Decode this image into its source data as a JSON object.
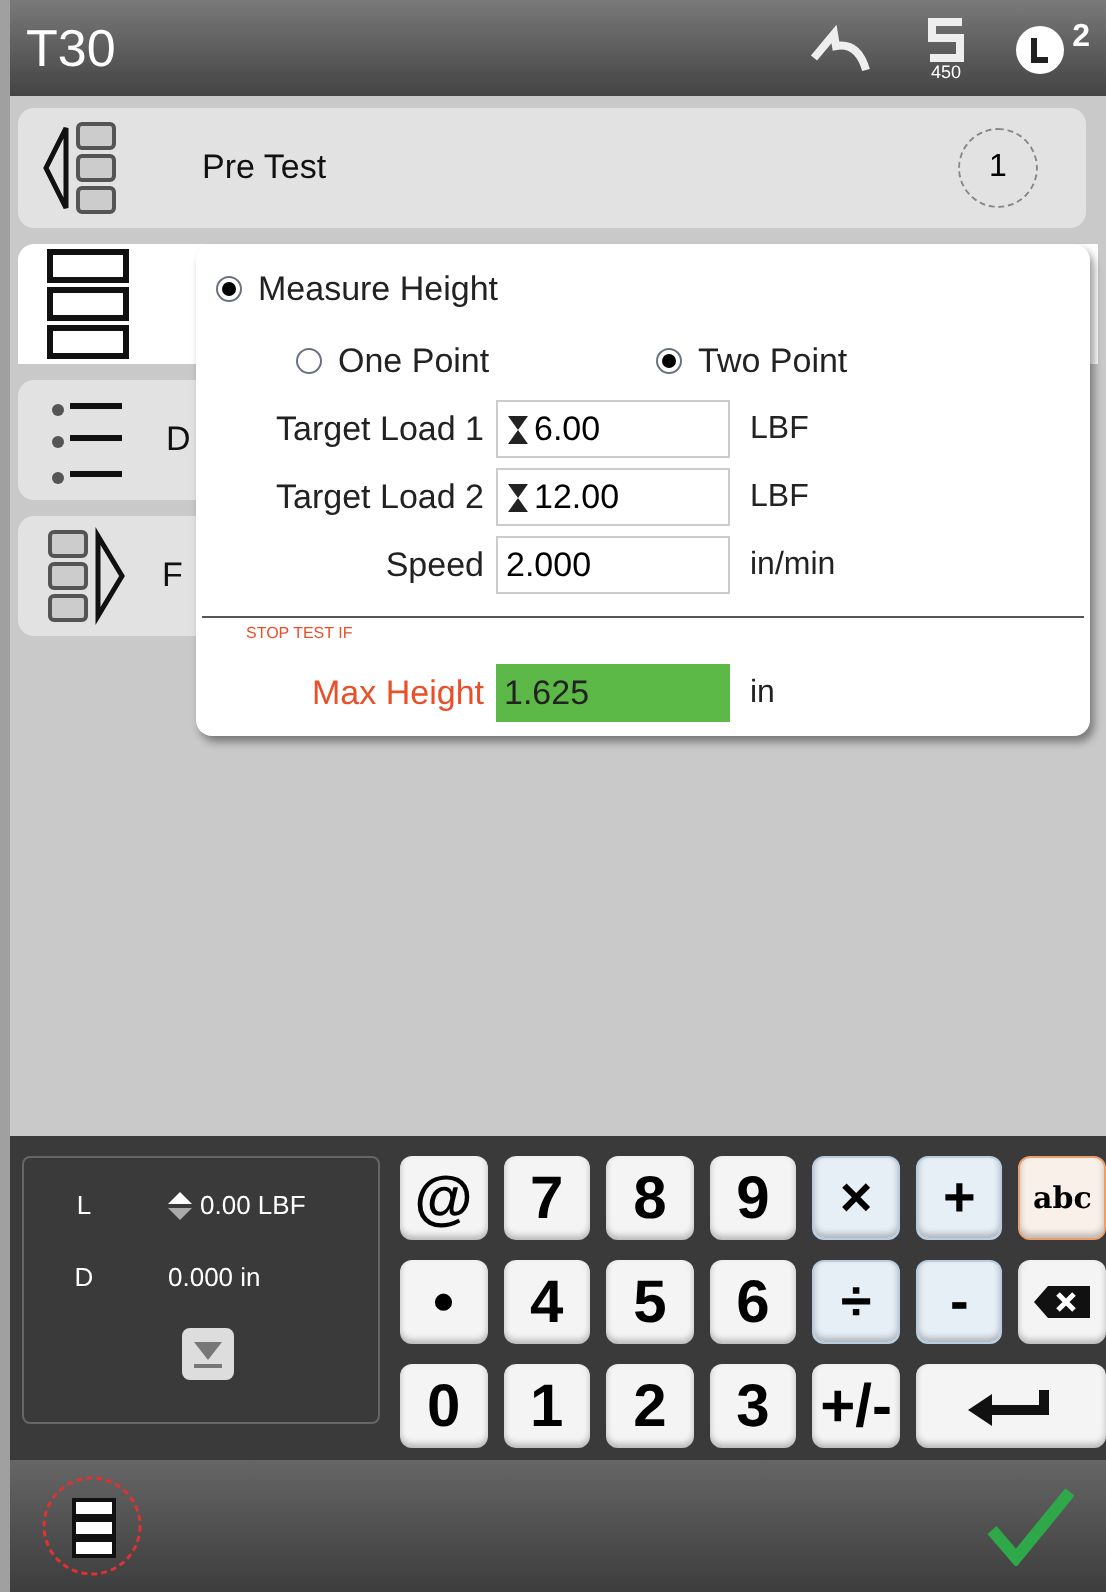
{
  "header": {
    "title": "T30",
    "badge_value": "450",
    "notification_count": "2"
  },
  "steps": [
    {
      "kind": "pretest",
      "label": "Pre Test",
      "count": "1",
      "selected": false
    },
    {
      "kind": "test",
      "selected": true
    },
    {
      "kind": "data",
      "label": "D",
      "selected": false
    },
    {
      "kind": "post",
      "label": "F",
      "selected": false
    }
  ],
  "popup": {
    "mode": {
      "label": "Measure Height",
      "selected": true
    },
    "options": [
      {
        "label": "One Point",
        "selected": false
      },
      {
        "label": "Two Point",
        "selected": true
      }
    ],
    "fields": [
      {
        "label": "Target Load 1",
        "value": "6.00",
        "unit": "LBF",
        "kind": "load"
      },
      {
        "label": "Target Load 2",
        "value": "12.00",
        "unit": "LBF",
        "kind": "load"
      },
      {
        "label": "Speed",
        "value": "2.000",
        "unit": "in/min",
        "kind": "plain"
      }
    ],
    "stop_heading": "STOP TEST IF",
    "limit": {
      "label": "Max Height",
      "value": "1.625",
      "unit": "in",
      "highlighted": true
    }
  },
  "readout": [
    {
      "axis": "L",
      "value": "0.00 LBF",
      "arrows": true
    },
    {
      "axis": "D",
      "value": "0.000 in",
      "arrows": false
    }
  ],
  "keys": [
    {
      "kind": "char",
      "label": "@"
    },
    {
      "kind": "char",
      "label": "7"
    },
    {
      "kind": "char",
      "label": "8"
    },
    {
      "kind": "char",
      "label": "9"
    },
    {
      "kind": "op",
      "label": "×"
    },
    {
      "kind": "op",
      "label": "+"
    },
    {
      "kind": "alpha",
      "label": "abc"
    },
    {
      "kind": "char",
      "label": "•"
    },
    {
      "kind": "char",
      "label": "4"
    },
    {
      "kind": "char",
      "label": "5"
    },
    {
      "kind": "char",
      "label": "6"
    },
    {
      "kind": "op",
      "label": "÷"
    },
    {
      "kind": "op",
      "label": "-"
    },
    {
      "kind": "backspace"
    },
    {
      "kind": "char",
      "label": "0"
    },
    {
      "kind": "char",
      "label": "1"
    },
    {
      "kind": "char",
      "label": "2"
    },
    {
      "kind": "char",
      "label": "3"
    },
    {
      "kind": "char",
      "label": "+/-"
    },
    {
      "kind": "enter"
    }
  ]
}
